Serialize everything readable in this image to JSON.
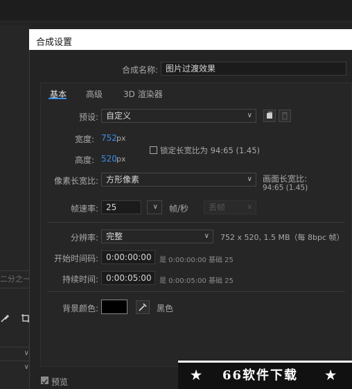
{
  "background": {
    "fraction_tab": "二分之一",
    "icon_left": "brush-icon",
    "icon_right": "crop-icon",
    "dropdown_arrows": [
      "∨",
      "∨"
    ]
  },
  "dialog": {
    "title": "合成设置",
    "comp_name_label": "合成名称:",
    "comp_name_value": "图片过渡效果",
    "tabs": [
      "基本",
      "高级",
      "3D 渲染器"
    ],
    "active_tab": "基本",
    "preset_label": "预设:",
    "preset_value": "自定义",
    "width_label": "宽度:",
    "width_value": "752",
    "width_unit": "px",
    "height_label": "高度:",
    "height_value": "520",
    "height_unit": "px",
    "lock_aspect_label": "锁定长宽比为 94:65 (1.45)",
    "lock_aspect_checked": false,
    "pixel_aspect_label": "像素长宽比:",
    "pixel_aspect_value": "方形像素",
    "frame_aspect_label": "画面长宽比:",
    "frame_aspect_value": "94:65 (1.45)",
    "frame_rate_label": "帧速率:",
    "frame_rate_value": "25",
    "frame_rate_unit": "帧/秒",
    "drop_frame_value": "丢帧",
    "resolution_label": "分辨率:",
    "resolution_value": "完整",
    "resolution_info": "752 x 520, 1.5 MB（每 8bpc 帧）",
    "start_tc_label": "开始时间码:",
    "start_tc_value": "0:00:00:00",
    "start_tc_info": "是 0:00:00:00  基础 25",
    "duration_label": "持续时间:",
    "duration_value": "0:00:05:00",
    "duration_info": "是 0:00:05:00  基础 25",
    "bg_color_label": "背景颜色:",
    "bg_color_value": "#000000",
    "bg_color_name": "黑色",
    "preview_label": "预览",
    "preview_checked": true
  },
  "watermark": {
    "text": "66软件下载",
    "star": "★"
  },
  "colors": {
    "accent_blue": "#3e8ee6",
    "title_bar": "#ffffff",
    "dialog_bg": "#232323"
  }
}
